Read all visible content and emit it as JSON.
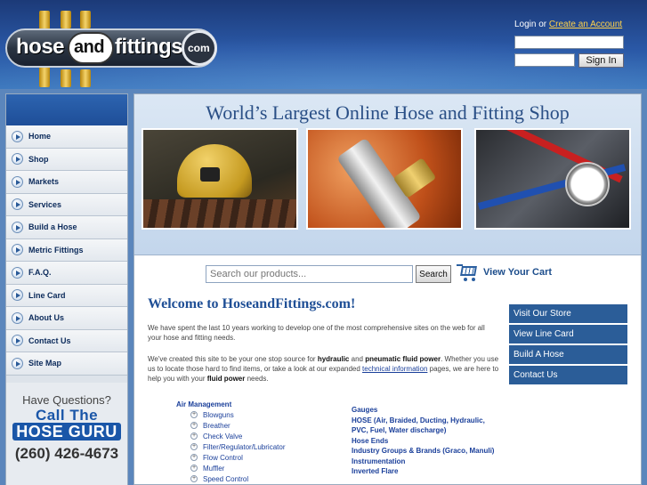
{
  "header": {
    "logo": {
      "word1": "hose",
      "word2": "and",
      "word3": "fittings",
      "word4": "com"
    },
    "login": {
      "text": "Login or ",
      "create_link": "Create an Account",
      "signin_label": "Sign In"
    }
  },
  "sidebar": {
    "items": [
      {
        "label": "Home"
      },
      {
        "label": "Shop"
      },
      {
        "label": "Markets"
      },
      {
        "label": "Services"
      },
      {
        "label": "Build a Hose"
      },
      {
        "label": "Metric Fittings"
      },
      {
        "label": "F.A.Q."
      },
      {
        "label": "Line Card"
      },
      {
        "label": "About Us"
      },
      {
        "label": "Contact Us"
      },
      {
        "label": "Site Map"
      }
    ],
    "guru": {
      "question": "Have Questions?",
      "call": "Call The",
      "hose_guru": "HOSE GURU",
      "phone": "(260) 426-4673"
    }
  },
  "banner": {
    "title": "World’s Largest Online Hose and Fitting Shop"
  },
  "search": {
    "placeholder": "Search our products...",
    "button": "Search",
    "cart_label": "View Your Cart"
  },
  "welcome": {
    "title": "Welcome to HoseandFittings.com!",
    "para1": "We have spent the last 10 years working to develop one of the most comprehensive sites on the web for all your hose and fitting needs.",
    "para2_a": "We've created this site to be your one stop source for ",
    "para2_b": "hydraulic",
    "para2_c": " and ",
    "para2_d": "pneumatic fluid power",
    "para2_e": ". Whether you use us to locate those hard to find items, or take a look at our expanded ",
    "para2_link": "technical information",
    "para2_f": " pages, we are here to help you with your ",
    "para2_g": "fluid power",
    "para2_h": " needs."
  },
  "quick_links": [
    {
      "label": "Visit Our Store"
    },
    {
      "label": "View Line Card"
    },
    {
      "label": "Build A Hose"
    },
    {
      "label": "Contact Us"
    }
  ],
  "categories_left": {
    "heading": "Air Management",
    "items": [
      "Blowguns",
      "Breather",
      "Check Valve",
      "Filter/Regulator/Lubricator",
      "Flow Control",
      "Muffler",
      "Speed Control"
    ]
  },
  "categories_right": [
    "Gauges",
    "HOSE (Air, Braided, Ducting, Hydraulic, PVC, Fuel, Water discharge)",
    "Hose Ends",
    "Industry Groups & Brands (Graco, Manuli)",
    "Instrumentation",
    "Inverted Flare"
  ],
  "colors": {
    "brand_blue": "#2b5d98",
    "link_blue": "#1a3f9a",
    "header_link": "#ffd24a"
  }
}
